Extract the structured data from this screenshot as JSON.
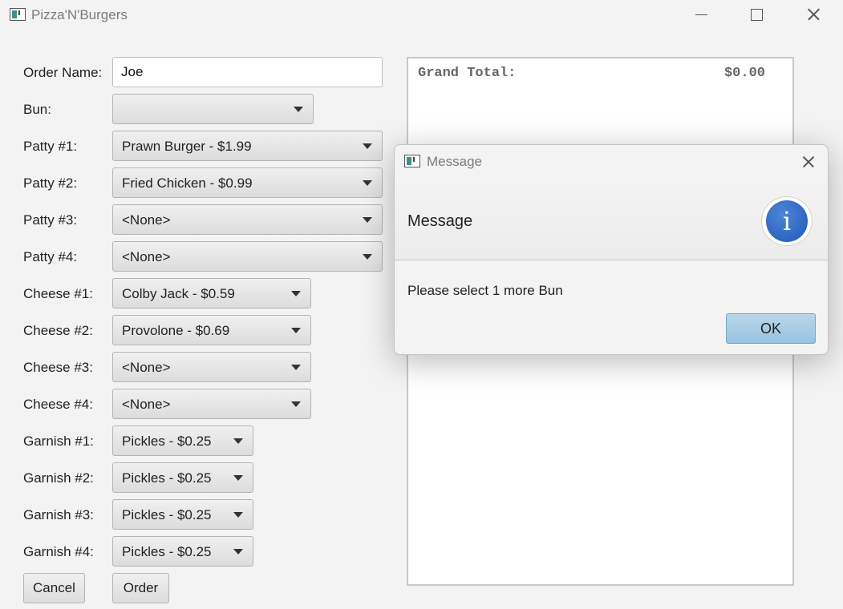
{
  "window": {
    "title": "Pizza'N'Burgers"
  },
  "form": {
    "order_name_label": "Order Name:",
    "order_name_value": "Joe",
    "bun_label": "Bun:",
    "bun_value": "",
    "patties": [
      {
        "label": "Patty #1:",
        "value": "Prawn Burger - $1.99"
      },
      {
        "label": "Patty #2:",
        "value": "Fried Chicken - $0.99"
      },
      {
        "label": "Patty #3:",
        "value": "<None>"
      },
      {
        "label": "Patty #4:",
        "value": "<None>"
      }
    ],
    "cheeses": [
      {
        "label": "Cheese #1:",
        "value": "Colby Jack - $0.59"
      },
      {
        "label": "Cheese #2:",
        "value": "Provolone - $0.69"
      },
      {
        "label": "Cheese #3:",
        "value": "<None>"
      },
      {
        "label": "Cheese #4:",
        "value": "<None>"
      }
    ],
    "garnishes": [
      {
        "label": "Garnish #1:",
        "value": "Pickles - $0.25"
      },
      {
        "label": "Garnish #2:",
        "value": "Pickles - $0.25"
      },
      {
        "label": "Garnish #3:",
        "value": "Pickles - $0.25"
      },
      {
        "label": "Garnish #4:",
        "value": "Pickles - $0.25"
      }
    ],
    "cancel_label": "Cancel",
    "order_label": "Order"
  },
  "receipt": {
    "grand_total_label": "Grand Total:",
    "grand_total_value": "$0.00"
  },
  "dialog": {
    "title": "Message",
    "heading": "Message",
    "info_glyph": "i",
    "content": "Please select 1 more Bun",
    "ok_label": "OK"
  }
}
